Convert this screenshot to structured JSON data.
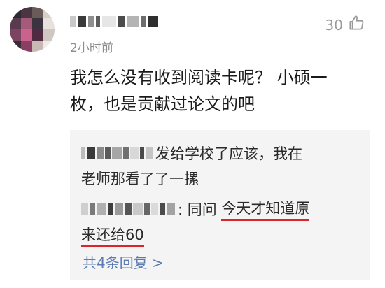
{
  "comment": {
    "time": "2小时前",
    "likes": "30",
    "text_line1": "我怎么没有收到阅读卡呢？ 小硕一",
    "text_line2": "枚，也是贡献过论文的吧"
  },
  "replies": [
    {
      "line1": "发给学校了应该，我在",
      "line2": "老师那看了了一摞"
    },
    {
      "prefix": ": 同问 ",
      "highlight1": "今天才知道原",
      "highlight2": "来还给60"
    }
  ],
  "more_replies": "共4条回复 >",
  "icons": {
    "like": "thumbs-up-icon"
  },
  "colors": {
    "underline": "#d8262a",
    "link": "#5b7cb5"
  }
}
